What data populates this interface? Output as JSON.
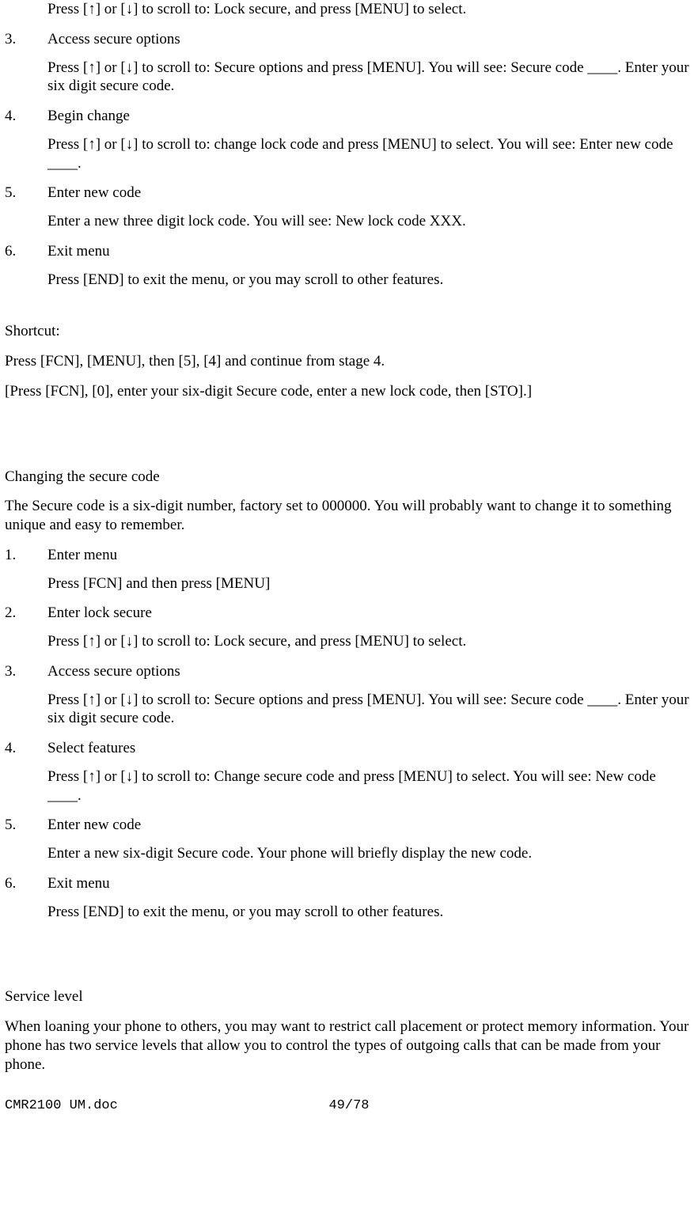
{
  "topStep": {
    "body": "Press [↑] or [↓] to scroll to: Lock secure, and press [MENU] to select."
  },
  "lockSteps": [
    {
      "num": "3.",
      "title": "Access secure options",
      "body": "Press [↑] or [↓] to scroll to: Secure options and press [MENU]. You will see: Secure code ____. Enter your six digit secure code."
    },
    {
      "num": "4.",
      "title": "Begin change",
      "body": "Press [↑] or [↓] to scroll to: change lock code and press [MENU] to select. You will see: Enter new code ____."
    },
    {
      "num": "5.",
      "title": "Enter new code",
      "body": "Enter a new three digit lock code. You will see: New lock code XXX."
    },
    {
      "num": "6.",
      "title": "Exit menu",
      "body": "Press [END] to exit the menu, or you may scroll to other features."
    }
  ],
  "shortcut": {
    "label": "Shortcut:",
    "line1": "Press [FCN], [MENU], then [5], [4] and continue from stage 4.",
    "line2": "[Press [FCN], [0], enter your six-digit Secure code, enter a new lock code, then [STO].]"
  },
  "secure": {
    "heading": "Changing the secure code",
    "intro": "The Secure code is a six-digit number, factory set to 000000. You will probably want to change it to something unique and easy to remember."
  },
  "secureSteps": [
    {
      "num": "1.",
      "title": "Enter menu",
      "body": "Press [FCN] and then press [MENU]"
    },
    {
      "num": "2.",
      "title": "Enter lock secure",
      "body": "Press [↑] or [↓] to scroll to: Lock secure, and press [MENU] to select."
    },
    {
      "num": "3.",
      "title": "Access secure options",
      "body": "Press [↑] or [↓] to scroll to: Secure options and press [MENU]. You will see: Secure code ____. Enter your six digit secure code."
    },
    {
      "num": "4.",
      "title": "Select features",
      "body": "Press [↑] or [↓] to scroll to: Change secure code and press [MENU] to select. You will see: New code ____."
    },
    {
      "num": "5.",
      "title": "Enter new code",
      "body": "Enter a new six-digit Secure code. Your phone will briefly display the new code."
    },
    {
      "num": "6.",
      "title": "Exit menu",
      "body": "Press [END] to exit the menu, or you may scroll to other features."
    }
  ],
  "service": {
    "heading": "Service level",
    "intro": "When loaning your phone to others, you may want to restrict call placement or protect memory information. Your phone has two service levels that allow you to control the types of outgoing calls that can be made from your phone."
  },
  "footer": {
    "left": "CMR2100 UM.doc",
    "center": "49/78"
  }
}
